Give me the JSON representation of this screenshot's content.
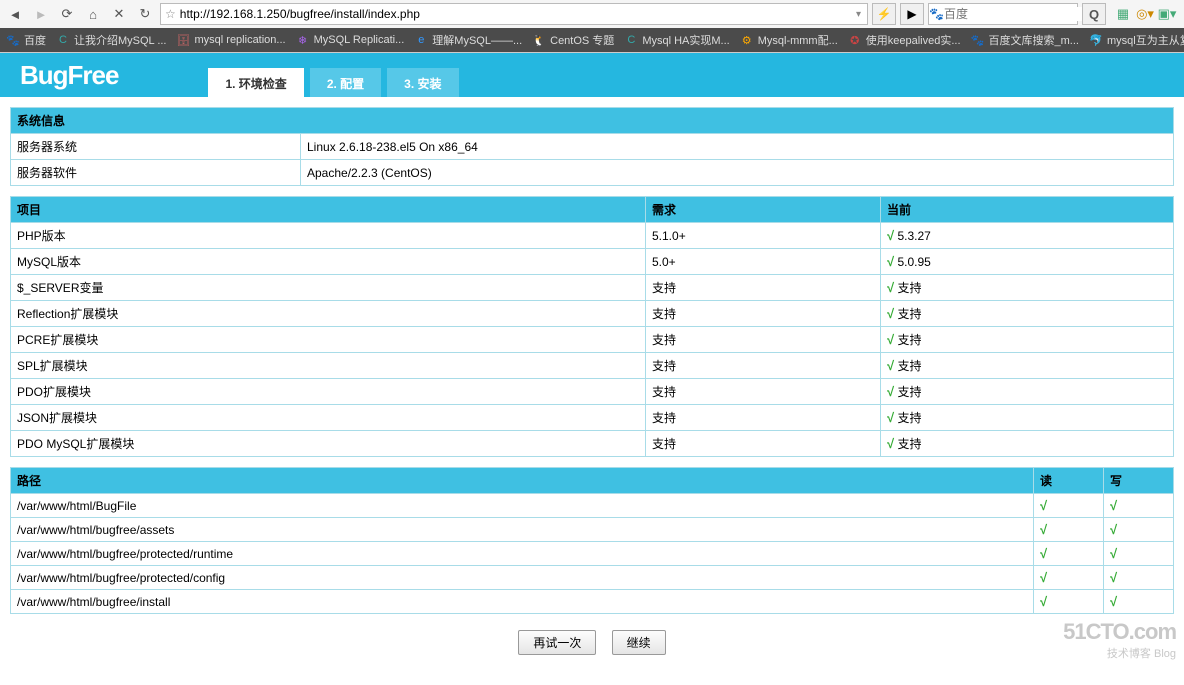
{
  "browser": {
    "url": "http://192.168.1.250/bugfree/install/index.php",
    "search_placeholder": "百度",
    "bookmarks": [
      {
        "icon": "🐾",
        "label": "百度",
        "color": "#36c"
      },
      {
        "icon": "C",
        "label": "让我介绍MySQL ...",
        "color": "#3aa"
      },
      {
        "icon": "🗄",
        "label": "mysql replication...",
        "color": "#c66"
      },
      {
        "icon": "❄",
        "label": "MySQL Replicati...",
        "color": "#a6e"
      },
      {
        "icon": "e",
        "label": "理解MySQL——...",
        "color": "#39f"
      },
      {
        "icon": "🐧",
        "label": "CentOS 专题",
        "color": "#fff"
      },
      {
        "icon": "C",
        "label": "Mysql HA实现M...",
        "color": "#3aa"
      },
      {
        "icon": "⚙",
        "label": "Mysql-mmm配...",
        "color": "#fa0"
      },
      {
        "icon": "✪",
        "label": "使用keepalived实...",
        "color": "#c44"
      },
      {
        "icon": "🐾",
        "label": "百度文库搜索_m...",
        "color": "#36c"
      },
      {
        "icon": "🐬",
        "label": "mysql互为主从复...",
        "color": "#f66"
      },
      {
        "icon": "C",
        "label": "",
        "color": "#3aa"
      }
    ]
  },
  "header": {
    "logo": "BugFree",
    "tabs": [
      "1. 环境检查",
      "2. 配置",
      "3. 安装"
    ]
  },
  "sysinfo": {
    "title": "系统信息",
    "rows": [
      {
        "label": "服务器系统",
        "value": "Linux 2.6.18-238.el5 On x86_64"
      },
      {
        "label": "服务器软件",
        "value": "Apache/2.2.3 (CentOS)"
      }
    ]
  },
  "items": {
    "headers": {
      "item": "项目",
      "req": "需求",
      "cur": "当前"
    },
    "rows": [
      {
        "label": "PHP版本",
        "req": "5.1.0+",
        "cur": "5.3.27"
      },
      {
        "label": "MySQL版本",
        "req": "5.0+",
        "cur": "5.0.95"
      },
      {
        "label": "$_SERVER变量",
        "req": "支持",
        "cur": "支持"
      },
      {
        "label": "Reflection扩展模块",
        "req": "支持",
        "cur": "支持"
      },
      {
        "label": "PCRE扩展模块",
        "req": "支持",
        "cur": "支持"
      },
      {
        "label": "SPL扩展模块",
        "req": "支持",
        "cur": "支持"
      },
      {
        "label": "PDO扩展模块",
        "req": "支持",
        "cur": "支持"
      },
      {
        "label": "JSON扩展模块",
        "req": "支持",
        "cur": "支持"
      },
      {
        "label": "PDO MySQL扩展模块",
        "req": "支持",
        "cur": "支持"
      }
    ]
  },
  "paths": {
    "headers": {
      "path": "路径",
      "read": "读",
      "write": "写"
    },
    "rows": [
      {
        "path": "/var/www/html/BugFile"
      },
      {
        "path": "/var/www/html/bugfree/assets"
      },
      {
        "path": "/var/www/html/bugfree/protected/runtime"
      },
      {
        "path": "/var/www/html/bugfree/protected/config"
      },
      {
        "path": "/var/www/html/bugfree/install"
      }
    ]
  },
  "buttons": {
    "retry": "再试一次",
    "continue": "继续"
  },
  "watermark": {
    "big": "51CTO.com",
    "small": "技术博客  Blog"
  }
}
